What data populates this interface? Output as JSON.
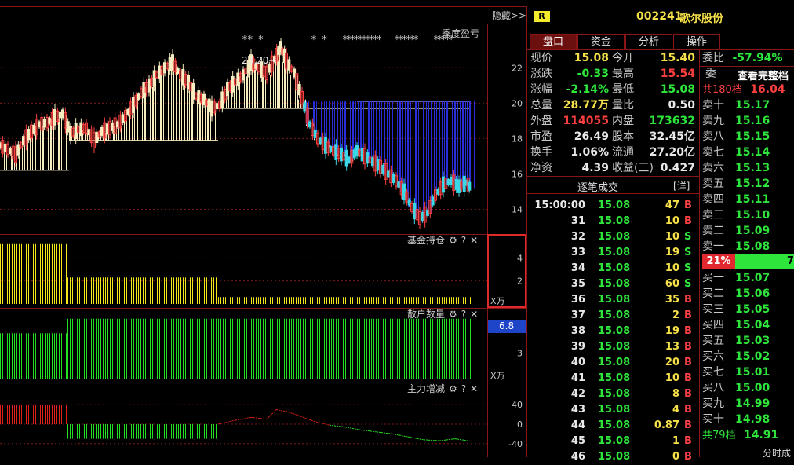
{
  "header": {
    "hide_label": "隐藏>>",
    "r_badge": "R",
    "stock_code": "002241",
    "stock_name": "歌尔股份"
  },
  "tabs": [
    "盘口",
    "资金",
    "分析",
    "操作"
  ],
  "chart_panels": {
    "main_label": "季度盈亏",
    "markers": [
      "** *",
      "* *",
      "**********",
      "******",
      "*****"
    ],
    "open_annotation": "23.20",
    "fund_label": "基金持仓",
    "retail_label": "散户数量",
    "main_force_label": "主力增减",
    "unit_wan": "X万",
    "retail_current": "6.8",
    "icons": [
      "gear-icon",
      "help-icon",
      "close-icon"
    ]
  },
  "chart_data": [
    {
      "type": "bar",
      "title": "季度盈亏",
      "yticks": [
        22,
        20,
        18,
        16,
        14
      ],
      "ylim": [
        12.6,
        24.5
      ],
      "notes": "price candles with quarterly shaded blocks; open annotation 23.20"
    },
    {
      "type": "bar",
      "title": "基金持仓",
      "yticks": [
        4,
        2
      ],
      "unit": "X万",
      "segments": [
        {
          "value": 5.2
        },
        {
          "value": 2.3
        },
        {
          "value": 0.6
        }
      ]
    },
    {
      "type": "bar",
      "title": "散户数量",
      "yticks": [
        6.8,
        3
      ],
      "unit": "X万",
      "segments": [
        {
          "value": 5.2
        },
        {
          "value": 6.8
        },
        {
          "value": 6.8
        }
      ]
    },
    {
      "type": "bar",
      "title": "主力增减",
      "yticks": [
        40,
        0,
        -40
      ],
      "segments": [
        {
          "value": 40
        },
        {
          "value": -30
        }
      ]
    }
  ],
  "quote": {
    "left": [
      {
        "label": "现价",
        "value": "15.08",
        "color": "yel"
      },
      {
        "label": "涨跌",
        "value": "-0.33",
        "color": "grn"
      },
      {
        "label": "涨幅",
        "value": "-2.14%",
        "color": "grn"
      },
      {
        "label": "总量",
        "value": "28.77万",
        "color": "yel"
      },
      {
        "label": "外盘",
        "value": "114055",
        "color": "red"
      },
      {
        "label": "市盈",
        "value": "26.49",
        "color": "wht"
      },
      {
        "label": "换手",
        "value": "1.06%",
        "color": "wht"
      },
      {
        "label": "净资",
        "value": "4.39",
        "color": "wht"
      }
    ],
    "right": [
      {
        "label": "今开",
        "value": "15.40",
        "color": "yel"
      },
      {
        "label": "最高",
        "value": "15.54",
        "color": "red"
      },
      {
        "label": "最低",
        "value": "15.08",
        "color": "grn"
      },
      {
        "label": "量比",
        "value": "0.50",
        "color": "wht"
      },
      {
        "label": "内盘",
        "value": "173632",
        "color": "grn"
      },
      {
        "label": "股本",
        "value": "32.45亿",
        "color": "wht"
      },
      {
        "label": "流通",
        "value": "27.20亿",
        "color": "wht"
      },
      {
        "label": "收益(三)",
        "value": "0.427",
        "color": "wht"
      }
    ]
  },
  "trades": {
    "title": "逐笔成交",
    "detail": "[详]",
    "rows": [
      {
        "time": "15:00:00",
        "price": "15.08",
        "vol": "47",
        "side": "B"
      },
      {
        "time": "31",
        "price": "15.08",
        "vol": "10",
        "side": "B"
      },
      {
        "time": "32",
        "price": "15.08",
        "vol": "10",
        "side": "S"
      },
      {
        "time": "33",
        "price": "15.08",
        "vol": "19",
        "side": "S"
      },
      {
        "time": "34",
        "price": "15.08",
        "vol": "10",
        "side": "S"
      },
      {
        "time": "35",
        "price": "15.08",
        "vol": "60",
        "side": "S"
      },
      {
        "time": "36",
        "price": "15.08",
        "vol": "35",
        "side": "B"
      },
      {
        "time": "37",
        "price": "15.08",
        "vol": "2",
        "side": "B"
      },
      {
        "time": "38",
        "price": "15.08",
        "vol": "19",
        "side": "B"
      },
      {
        "time": "39",
        "price": "15.08",
        "vol": "13",
        "side": "B"
      },
      {
        "time": "40",
        "price": "15.08",
        "vol": "20",
        "side": "B"
      },
      {
        "time": "41",
        "price": "15.08",
        "vol": "10",
        "side": "B"
      },
      {
        "time": "42",
        "price": "15.08",
        "vol": "8",
        "side": "B"
      },
      {
        "time": "43",
        "price": "15.08",
        "vol": "4",
        "side": "B"
      },
      {
        "time": "44",
        "price": "15.08",
        "vol": "0.87",
        "side": "B"
      },
      {
        "time": "45",
        "price": "15.08",
        "vol": "1",
        "side": "B"
      },
      {
        "time": "46",
        "price": "15.08",
        "vol": "0",
        "side": "B"
      }
    ]
  },
  "book": {
    "ratio_label": "委比",
    "ratio_value": "-57.94%",
    "ratio_suffix": "委",
    "view_all": "查看完整档",
    "total_ask_label": "共180档",
    "total_ask_value": "16.04",
    "asks": [
      {
        "label": "卖十",
        "price": "15.17"
      },
      {
        "label": "卖九",
        "price": "15.16"
      },
      {
        "label": "卖八",
        "price": "15.15"
      },
      {
        "label": "卖七",
        "price": "15.14"
      },
      {
        "label": "卖六",
        "price": "15.13"
      },
      {
        "label": "卖五",
        "price": "15.12"
      },
      {
        "label": "卖四",
        "price": "15.11"
      },
      {
        "label": "卖三",
        "price": "15.10"
      },
      {
        "label": "卖二",
        "price": "15.09"
      },
      {
        "label": "卖一",
        "price": "15.08"
      }
    ],
    "bar_left": "21%",
    "bar_right": "7",
    "bids": [
      {
        "label": "买一",
        "price": "15.07"
      },
      {
        "label": "买二",
        "price": "15.06"
      },
      {
        "label": "买三",
        "price": "15.05"
      },
      {
        "label": "买四",
        "price": "15.04"
      },
      {
        "label": "买五",
        "price": "15.03"
      },
      {
        "label": "买六",
        "price": "15.02"
      },
      {
        "label": "买七",
        "price": "15.01"
      },
      {
        "label": "买八",
        "price": "15.00"
      },
      {
        "label": "买九",
        "price": "14.99"
      },
      {
        "label": "买十",
        "price": "14.98"
      }
    ],
    "total_bid_label": "共79档",
    "total_bid_value": "14.91",
    "bottom_label": "分时成"
  }
}
